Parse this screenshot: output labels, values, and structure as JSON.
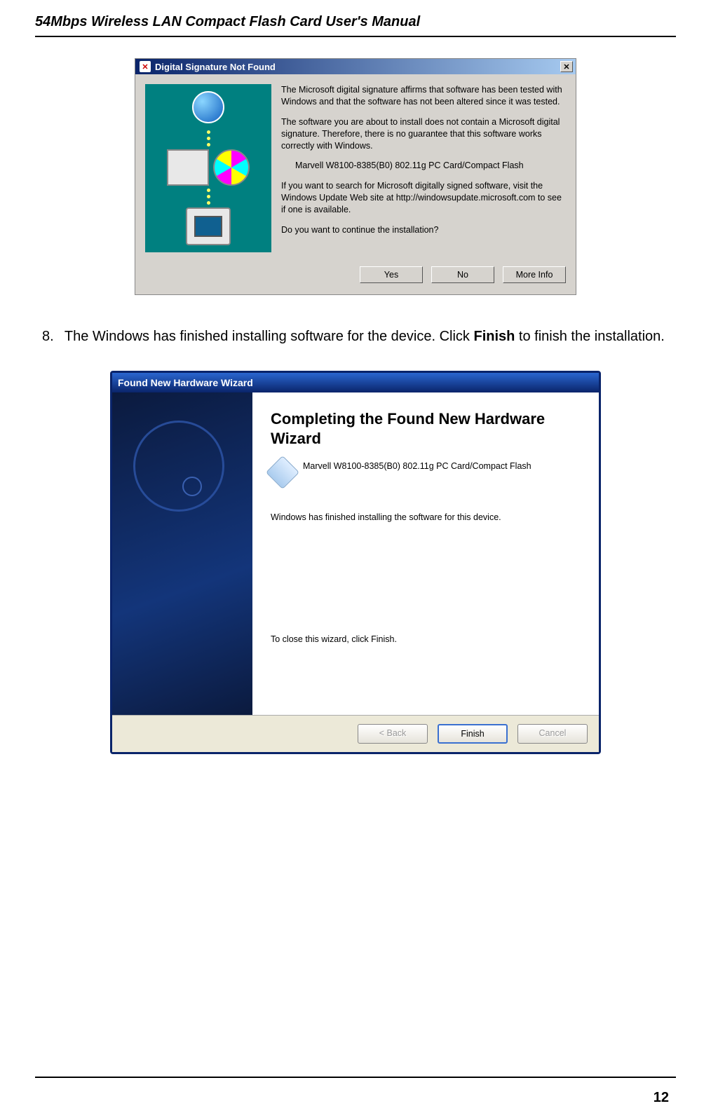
{
  "doc": {
    "header": "54Mbps Wireless LAN Compact Flash Card User's Manual",
    "page": "12"
  },
  "instruction": {
    "num": "8.",
    "text_before_bold": "The Windows has finished installing software for the device. Click ",
    "bold": "Finish",
    "text_after_bold": " to finish the installation."
  },
  "dlg1": {
    "title": "Digital Signature Not Found",
    "p1": "The Microsoft digital signature affirms that software has been tested with Windows and that the software has not been altered since it was tested.",
    "p2": "The software you are about to install does not contain a Microsoft digital signature. Therefore, there is no guarantee that this software works correctly with Windows.",
    "device": "Marvell W8100-8385(B0) 802.11g PC Card/Compact Flash",
    "p3": "If you want to search for Microsoft digitally signed software, visit the Windows Update Web site at http://windowsupdate.microsoft.com to see if one is available.",
    "p4": "Do you want to continue the installation?",
    "btn_yes": "Yes",
    "btn_no": "No",
    "btn_more": "More Info"
  },
  "dlg2": {
    "title": "Found New Hardware Wizard",
    "heading": "Completing the Found New Hardware Wizard",
    "device": "Marvell W8100-8385(B0) 802.11g PC Card/Compact Flash",
    "status": "Windows has finished installing the software for this device.",
    "close_hint": "To close this wizard, click Finish.",
    "btn_back": "< Back",
    "btn_finish": "Finish",
    "btn_cancel": "Cancel"
  }
}
